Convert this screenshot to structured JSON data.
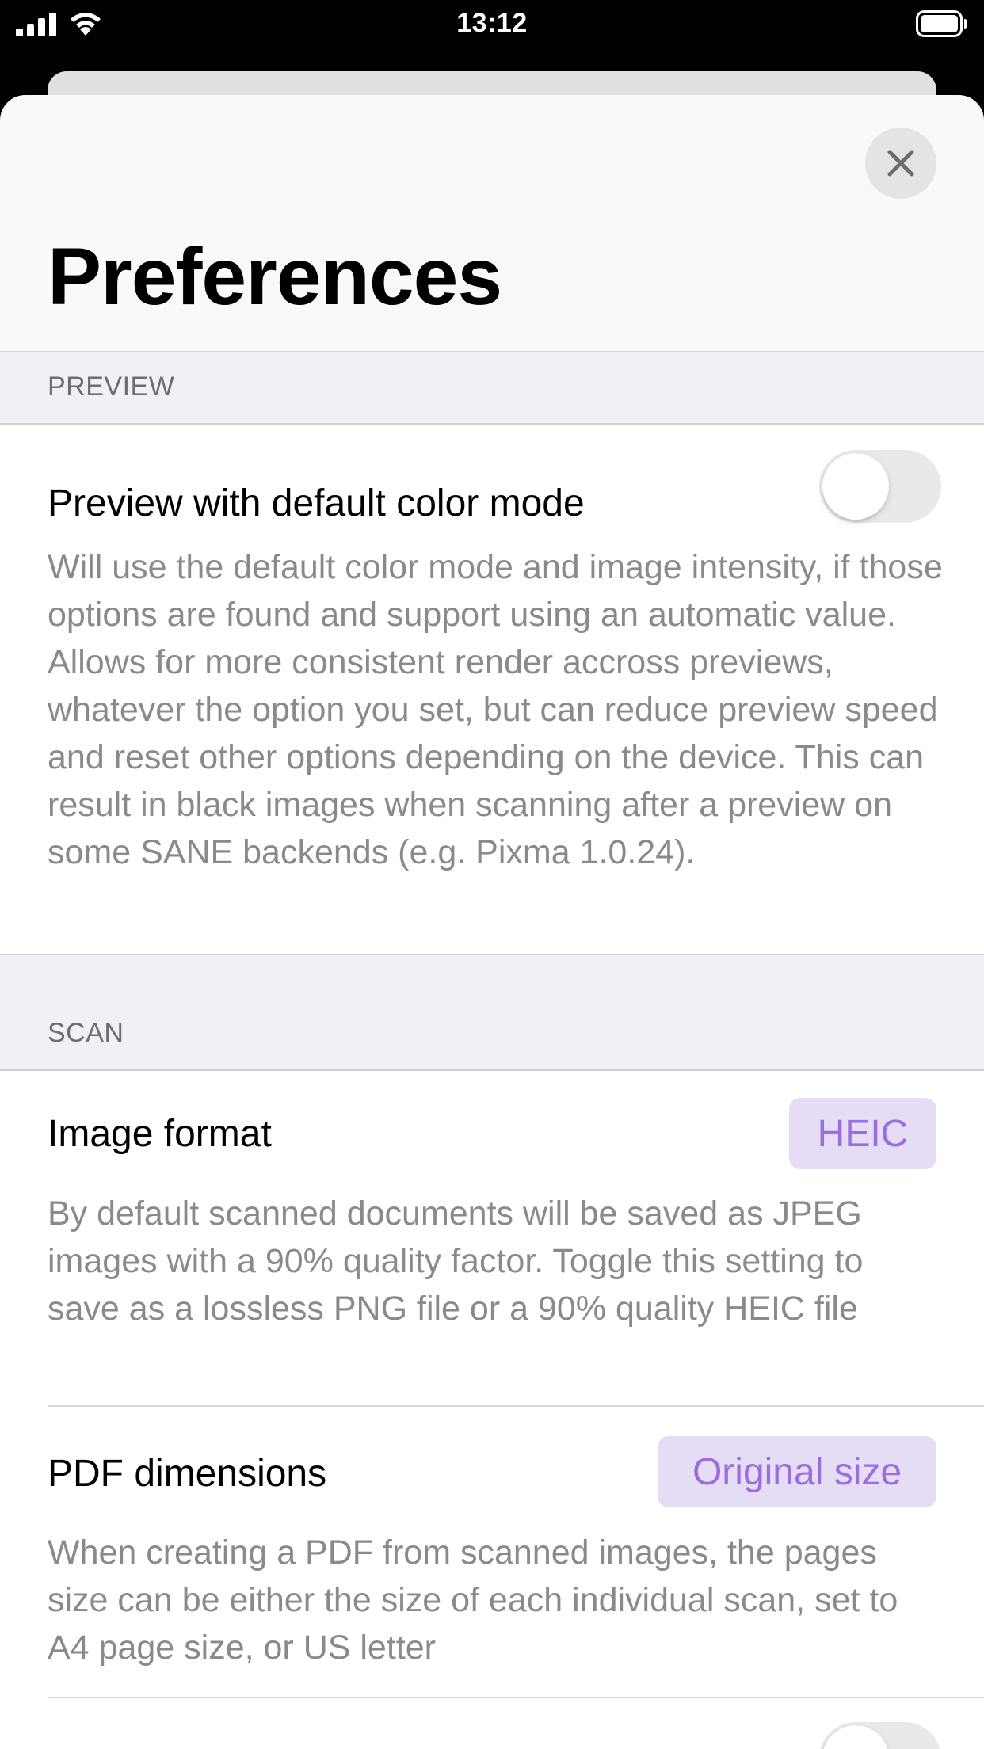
{
  "status_bar": {
    "time": "13:12",
    "icons": [
      "cellular-signal-icon",
      "wifi-icon",
      "battery-icon"
    ]
  },
  "sheet": {
    "close_icon": "close-icon",
    "title": "Preferences"
  },
  "sections": {
    "preview": {
      "header": "PREVIEW",
      "rows": [
        {
          "label": "Preview with default color mode",
          "toggle_on": false,
          "description": "Will use the default color mode and image intensity, if those options are found and support using an automatic value. Allows for more consistent render accross previews, whatever the option you set, but can reduce preview speed and reset other options depending on the device. This can result in black images when scanning after a preview on some SANE backends (e.g. Pixma 1.0.24)."
        }
      ]
    },
    "scan": {
      "header": "SCAN",
      "rows": [
        {
          "label": "Image format",
          "value": "HEIC",
          "description": "By default scanned documents will be saved as JPEG images with a 90% quality factor. Toggle this setting to save as a lossless PNG file or a 90% quality HEIC file"
        },
        {
          "label": "PDF dimensions",
          "value": "Original size",
          "description": "When creating a PDF from scanned images, the pages size can be either the size of each individual scan, set to A4 page size, or US letter"
        },
        {
          "label": "",
          "toggle_on": false
        }
      ]
    }
  },
  "colors": {
    "accent_text": "#9b6ee0",
    "accent_background": "#e5dcf6",
    "toggle_off": "#e9e9eb",
    "section_background": "#f0f0f5"
  }
}
